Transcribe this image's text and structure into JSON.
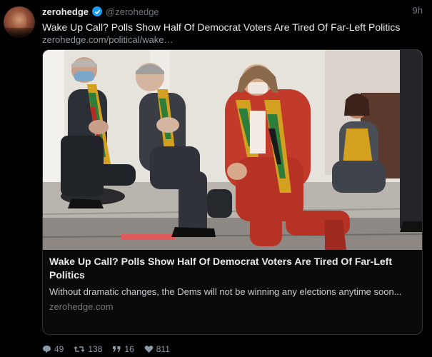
{
  "tweet": {
    "name": "zerohedge",
    "handle": "@zerohedge",
    "time": "9h",
    "text": "Wake Up Call? Polls Show Half Of Democrat Voters Are Tired Of Far-Left Politics",
    "link": "zerohedge.com/political/wake…"
  },
  "card": {
    "title": "Wake Up Call? Polls Show Half Of Democrat Voters Are Tired Of Far-Left Politics",
    "description": "Without dramatic changes, the Dems will not be winning any elections anytime soon...",
    "domain": "zerohedge.com"
  },
  "actions": {
    "replies": "49",
    "retweets": "138",
    "quotes": "16",
    "likes": "811"
  },
  "colors": {
    "verified": "#1d9bf0",
    "muted": "#71767b",
    "jacket": "#c23a2a",
    "kente": "#d4a020"
  },
  "icons": [
    "verified-icon",
    "reply-icon",
    "retweet-icon",
    "quote-icon",
    "like-icon"
  ]
}
